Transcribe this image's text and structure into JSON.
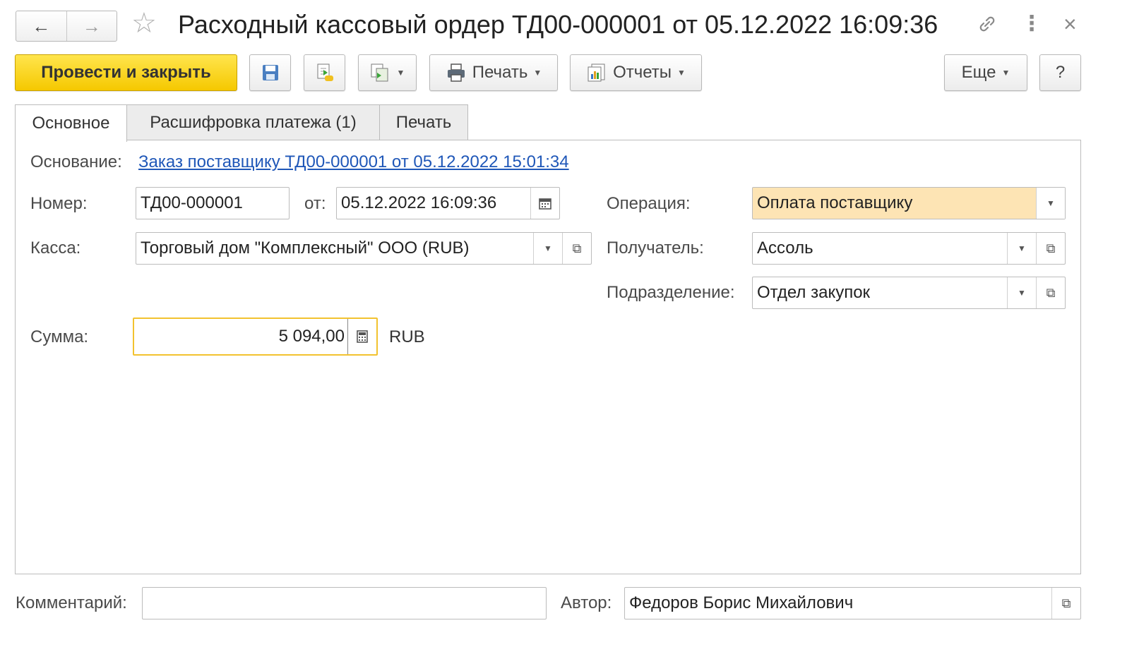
{
  "header": {
    "back_icon": "←",
    "forward_icon": "→",
    "favorite_icon": "☆",
    "title": "Расходный кассовый ордер ТД00-000001 от 05.12.2022 16:09:36",
    "link_icon": "🔗",
    "menu_icon": "⋮",
    "close_icon": "×"
  },
  "toolbar": {
    "post_close_label": "Провести и закрыть",
    "print_label": "Печать",
    "reports_label": "Отчеты",
    "more_label": "Еще",
    "help_label": "?"
  },
  "tabs": [
    {
      "label": "Основное"
    },
    {
      "label": "Расшифровка платежа (1)"
    },
    {
      "label": "Печать"
    }
  ],
  "form": {
    "basis_label": "Основание:",
    "basis_link": "Заказ поставщику ТД00-000001 от 05.12.2022 15:01:34",
    "number_label": "Номер:",
    "number_value": "ТД00-000001",
    "date_label": "от:",
    "date_value": "05.12.2022 16:09:36",
    "operation_label": "Операция:",
    "operation_value": "Оплата поставщику",
    "cashbox_label": "Касса:",
    "cashbox_value": "Торговый дом \"Комплексный\" ООО (RUB)",
    "recipient_label": "Получатель:",
    "recipient_value": "Ассоль",
    "department_label": "Подразделение:",
    "department_value": "Отдел закупок",
    "amount_label": "Сумма:",
    "amount_value": "5 094,00",
    "currency": "RUB"
  },
  "footer": {
    "comment_label": "Комментарий:",
    "comment_value": "",
    "author_label": "Автор:",
    "author_value": "Федоров Борис Михайлович"
  },
  "colors": {
    "primary_button": "#f5c800",
    "operation_field_bg": "#fde4b4",
    "amount_focus_border": "#f2c22f",
    "link": "#1f57b8"
  }
}
